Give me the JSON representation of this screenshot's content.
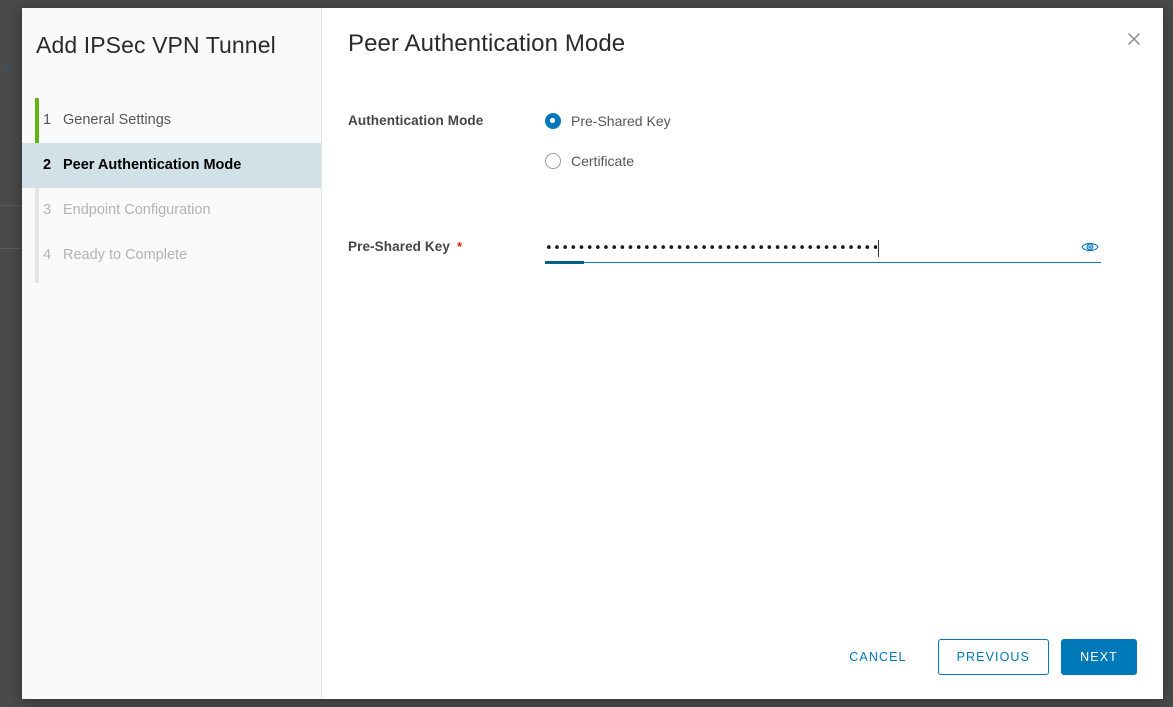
{
  "backdrop": {
    "ghost_text": "C"
  },
  "wizard": {
    "title": "Add IPSec VPN Tunnel",
    "steps": [
      {
        "num": "1",
        "label": "General Settings",
        "state": "completed"
      },
      {
        "num": "2",
        "label": "Peer Authentication Mode",
        "state": "active"
      },
      {
        "num": "3",
        "label": "Endpoint Configuration",
        "state": "disabled"
      },
      {
        "num": "4",
        "label": "Ready to Complete",
        "state": "disabled"
      }
    ]
  },
  "pane": {
    "title": "Peer Authentication Mode",
    "close_icon": "close-icon"
  },
  "form": {
    "auth_mode": {
      "label": "Authentication Mode",
      "options": [
        {
          "label": "Pre-Shared Key",
          "selected": true
        },
        {
          "label": "Certificate",
          "selected": false
        }
      ]
    },
    "pre_shared_key": {
      "label": "Pre-Shared Key",
      "required_marker": "*",
      "value_masked": "••••••••••••••••••••••••••••••••••••••••••••••••••••",
      "placeholder": "",
      "reveal_icon": "eye-icon"
    }
  },
  "footer": {
    "cancel_label": "CANCEL",
    "previous_label": "PREVIOUS",
    "next_label": "NEXT"
  },
  "colors": {
    "accent": "#0079b8",
    "accent_dark": "#00608a",
    "step_done": "#60b515",
    "step_track": "#e3e3e3",
    "active_row": "#d2e0e8",
    "required": "#e02200",
    "backdrop": "#4a4a4a"
  }
}
